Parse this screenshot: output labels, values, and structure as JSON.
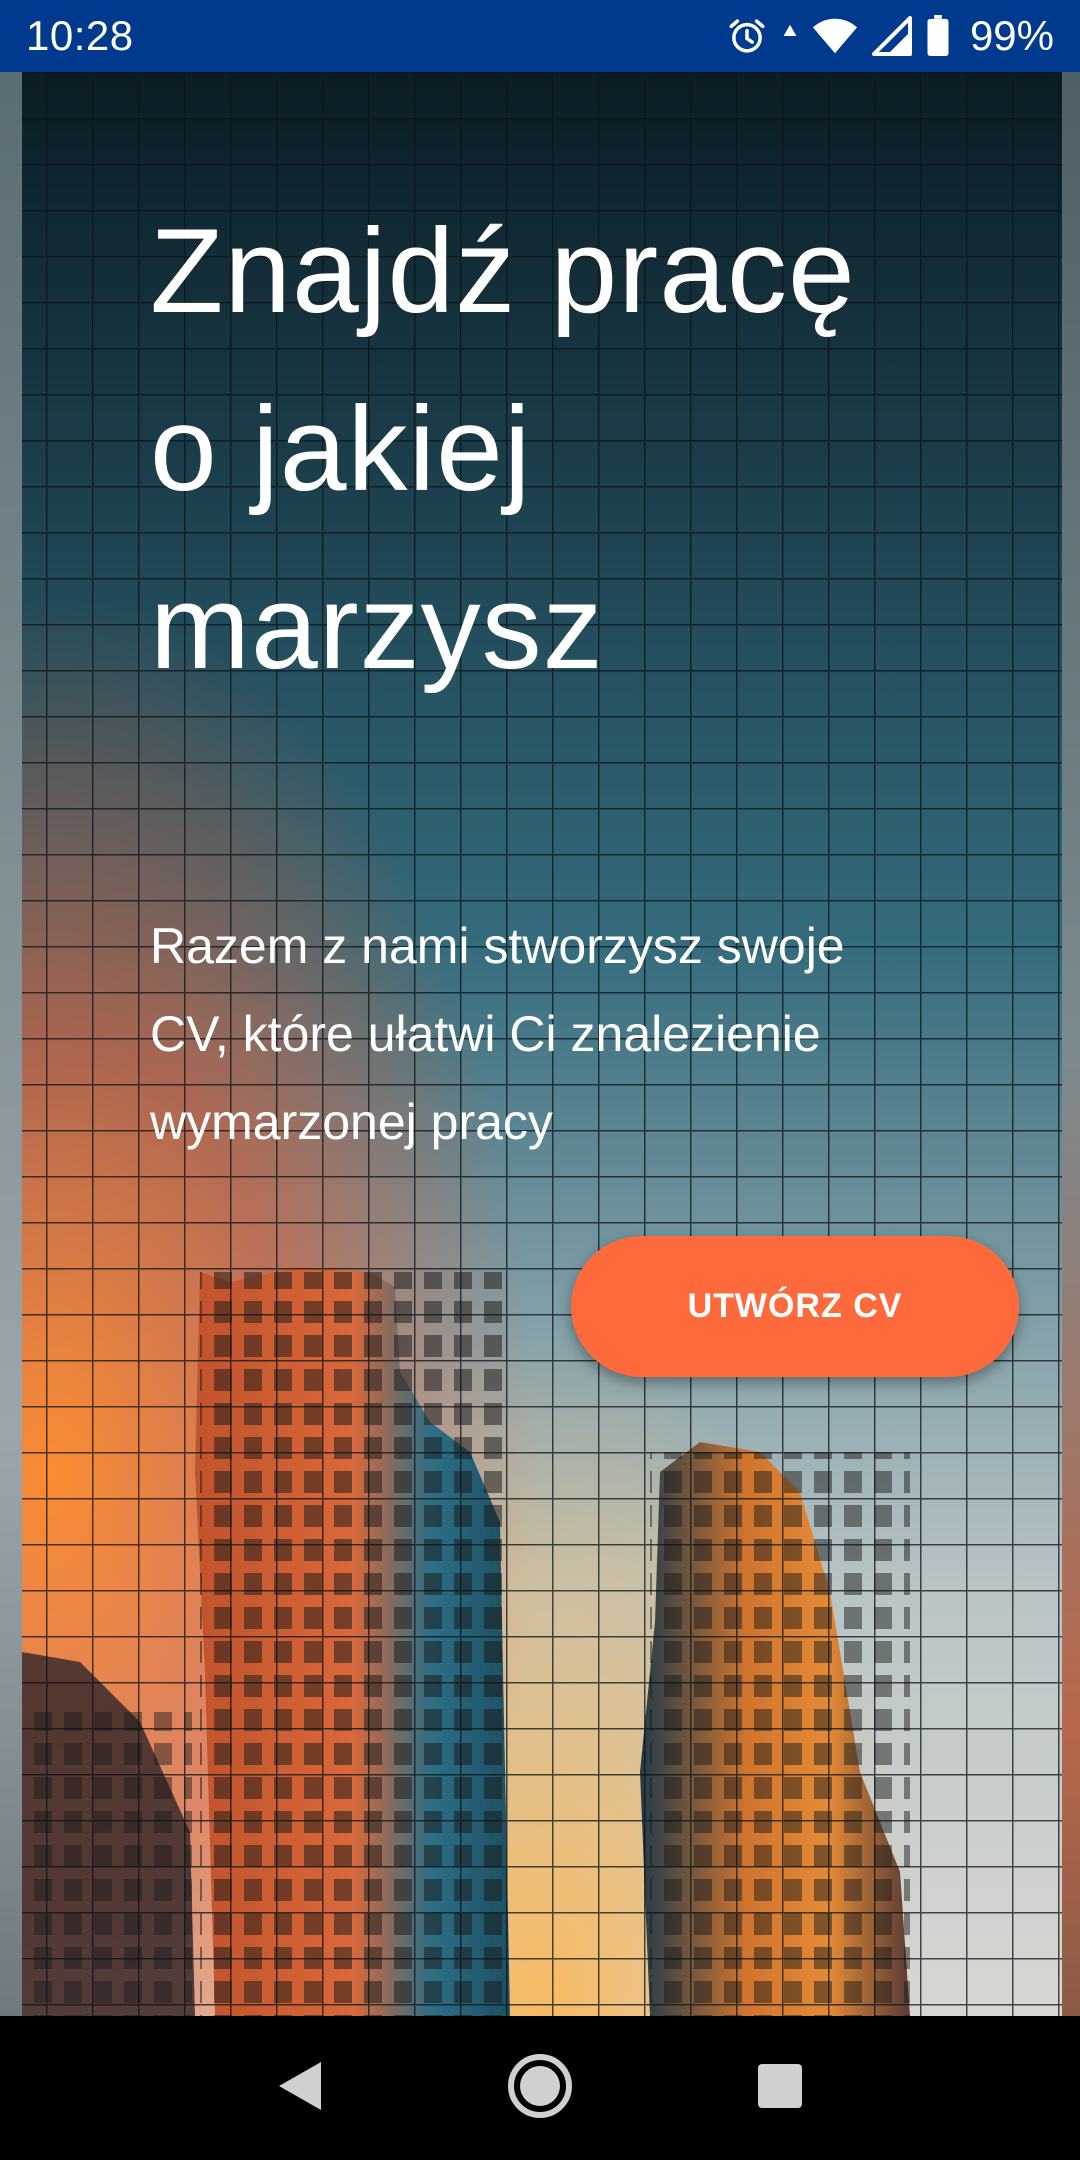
{
  "status_bar": {
    "time": "10:28",
    "battery_percent": "99%",
    "icons": [
      "alarm-icon",
      "data-arrow-icon",
      "wifi-icon",
      "signal-icon",
      "battery-icon"
    ]
  },
  "hero": {
    "headline_lines": [
      "Znajdź pracę",
      "o jakiej",
      "marzysz"
    ],
    "subtitle_lines": [
      "Razem z nami stworzysz swoje",
      "CV, które ułatwi Ci znalezienie",
      "wymarzonej pracy"
    ],
    "cta_label": "UTWÓRZ CV"
  },
  "navigation": {
    "buttons": [
      "back-icon",
      "home-icon",
      "recents-icon"
    ]
  },
  "colors": {
    "status_bar": "#003a8f",
    "cta": "#ff6a3d",
    "text": "#ffffff"
  }
}
